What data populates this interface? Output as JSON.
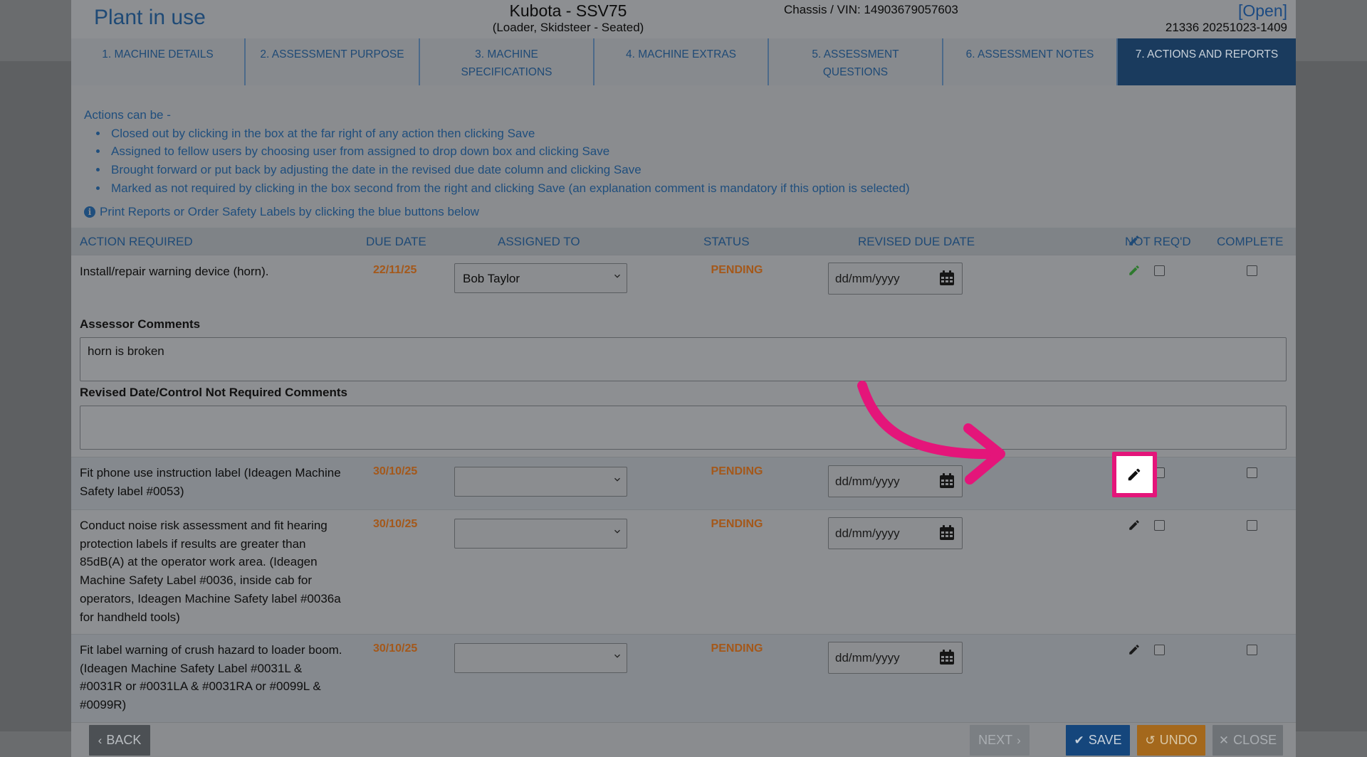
{
  "header": {
    "title": "Plant in use",
    "machine": "Kubota - SSV75",
    "machine_type": "(Loader, Skidsteer - Seated)",
    "vin": "Chassis / VIN: 14903679057603",
    "status": "[Open]",
    "reference": "21336 20251023-1409"
  },
  "tabs": [
    {
      "label": "1. MACHINE DETAILS"
    },
    {
      "label": "2. ASSESSMENT PURPOSE"
    },
    {
      "label": "3. MACHINE SPECIFICATIONS"
    },
    {
      "label": "4. MACHINE EXTRAS"
    },
    {
      "label": "5. ASSESSMENT QUESTIONS"
    },
    {
      "label": "6. ASSESSMENT NOTES"
    },
    {
      "label": "7. ACTIONS AND REPORTS"
    }
  ],
  "active_tab": "7. ACTIONS AND REPORTS",
  "intro": {
    "heading": "Actions can be -",
    "bullets": [
      "Closed out by clicking in the box at the far right of any action then clicking Save",
      "Assigned to fellow users by choosing user from assigned to drop down box and clicking Save",
      "Brought forward or put back by adjusting the date in the revised due date column and clicking Save",
      "Marked as not required by clicking in the box second from the right and clicking Save (an explanation comment is mandatory if this option is selected)"
    ],
    "info": "Print Reports or Order Safety Labels by clicking the blue buttons below"
  },
  "table": {
    "headers": {
      "action": "ACTION REQUIRED",
      "due": "DUE DATE",
      "assigned": "ASSIGNED TO",
      "status": "STATUS",
      "revised": "REVISED DUE DATE",
      "not_required": "NOT REQ'D",
      "complete": "COMPLETE"
    },
    "date_placeholder": "dd/mm/yyyy",
    "rows": [
      {
        "action": "Install/repair warning device (horn).",
        "due": "22/11/25",
        "assigned": "Bob Taylor",
        "status": "PENDING",
        "revised": "dd/mm/yyyy"
      },
      {
        "action": "Fit phone use instruction label (Ideagen Machine Safety label #0053)",
        "due": "30/10/25",
        "assigned": "",
        "status": "PENDING",
        "revised": "dd/mm/yyyy"
      },
      {
        "action": "Conduct noise risk assessment and fit hearing protection labels if results are greater than 85dB(A) at the operator work area. (Ideagen Machine Safety Label #0036, inside cab for operators, Ideagen Machine Safety label #0036a for handheld tools)",
        "due": "30/10/25",
        "assigned": "",
        "status": "PENDING",
        "revised": "dd/mm/yyyy"
      },
      {
        "action": "Fit label warning of crush hazard to loader boom. (Ideagen Machine Safety Label #0031L & #0031R or #0031LA & #0031RA or #0099L & #0099R)",
        "due": "30/10/25",
        "assigned": "",
        "status": "PENDING",
        "revised": "dd/mm/yyyy"
      }
    ]
  },
  "comments": {
    "assessor_label": "Assessor Comments",
    "assessor_value": "horn is broken",
    "revised_label": "Revised Date/Control Not Required Comments",
    "revised_value": ""
  },
  "footer": {
    "back": "BACK",
    "next": "NEXT",
    "save": "SAVE",
    "undo": "UNDO",
    "close": "CLOSE"
  },
  "colors": {
    "annotation": "#e4157a",
    "pending": "#a4581a",
    "active_tab": "#1a3b5e",
    "save": "#15467c",
    "undo": "#a4681c"
  }
}
